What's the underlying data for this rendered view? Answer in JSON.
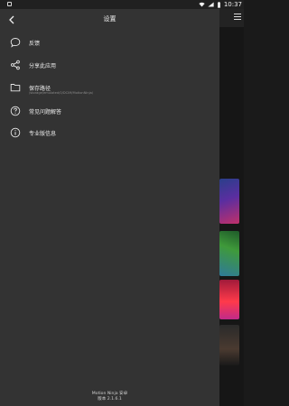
{
  "status": {
    "time": "10:37"
  },
  "drawer": {
    "title": "设置",
    "items": [
      {
        "icon": "chat-bubble-icon",
        "label": "反馈"
      },
      {
        "icon": "share-icon",
        "label": "分享此应用"
      },
      {
        "icon": "folder-icon",
        "label": "保存路径",
        "sub": "/storage/emulated/0/DCIM/MotionNinja/"
      },
      {
        "icon": "help-circle-icon",
        "label": "常见问题解答"
      },
      {
        "icon": "info-circle-icon",
        "label": "专业版信息"
      }
    ],
    "footer": {
      "line1": "Motion Ninja 安卓",
      "line2": "版本 2.1.6.1"
    }
  }
}
